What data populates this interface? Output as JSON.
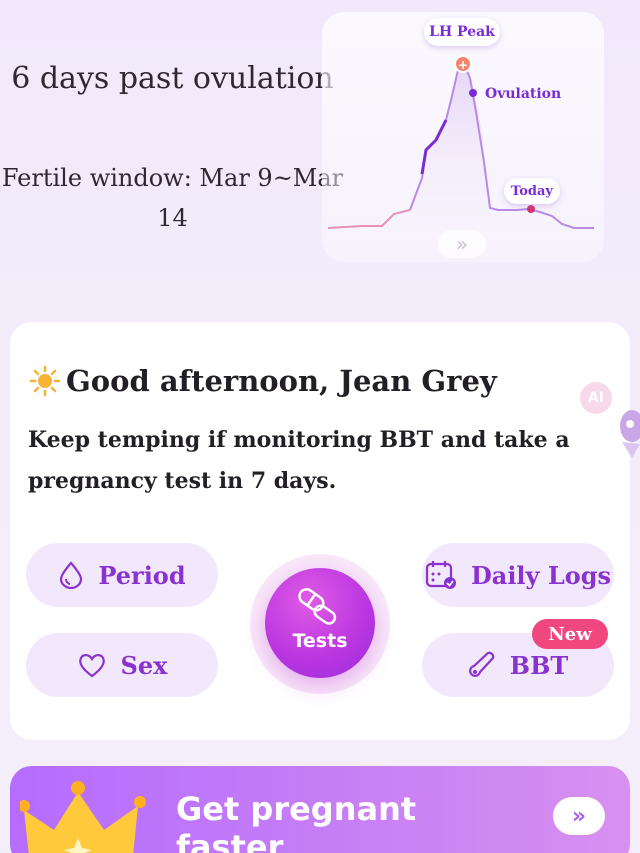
{
  "cycle_status": {
    "days_past": "6 days past ovulation",
    "fertile_window": "Fertile window: Mar 9~Mar 14"
  },
  "chart": {
    "lh_peak_label": "LH Peak",
    "ovulation_label": "Ovulation",
    "today_label": "Today",
    "more_icon": "double-chevron-right-icon",
    "line_color": "#b88ae6",
    "accent_color": "#7a2bd6"
  },
  "greeting": {
    "icon": "sun-icon",
    "text": "Good afternoon, Jean Grey",
    "advice": "Keep temping if monitoring BBT and take a pregnancy test in 7 days.",
    "ai_badge": "AI"
  },
  "actions": {
    "period": "Period",
    "sex": "Sex",
    "tests": "Tests",
    "daily_logs": "Daily Logs",
    "bbt": "BBT",
    "bbt_badge": "New"
  },
  "promo": {
    "text": "Get pregnant faster",
    "arrow_icon": "double-chevron-right-icon"
  },
  "colors": {
    "brand_purple": "#8a32cf",
    "new_badge": "#f0477f",
    "pill_bg": "#f2e8fb"
  }
}
